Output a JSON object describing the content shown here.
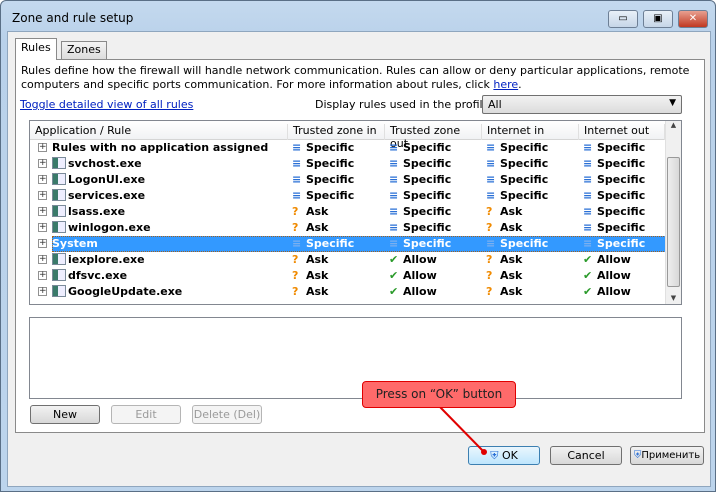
{
  "window": {
    "title": "Zone and rule setup",
    "minimize": "▭",
    "maximize": "▣",
    "close": "✕"
  },
  "tabs": [
    {
      "label": "Rules",
      "active": true
    },
    {
      "label": "Zones",
      "active": false
    }
  ],
  "description": "Rules define how the firewall will handle network communication. Rules can allow or deny particular applications, remote computers and specific ports communication. For more information about rules, click ",
  "here_link": "here",
  "toggle_link": "Toggle detailed view of all rules",
  "profile_label": "Display rules used in the profile:",
  "profile_value": "All",
  "columns": [
    "Application / Rule",
    "Trusted zone in",
    "Trusted zone out",
    "Internet in",
    "Internet out"
  ],
  "rows": [
    {
      "name": "Rules with no application assigned",
      "icon": "none",
      "vals": [
        "Specific",
        "Specific",
        "Specific",
        "Specific"
      ]
    },
    {
      "name": "svchost.exe",
      "icon": "app-window-icon",
      "vals": [
        "Specific",
        "Specific",
        "Specific",
        "Specific"
      ]
    },
    {
      "name": "LogonUI.exe",
      "icon": "app-window-icon",
      "vals": [
        "Specific",
        "Specific",
        "Specific",
        "Specific"
      ]
    },
    {
      "name": "services.exe",
      "icon": "app-window-icon",
      "vals": [
        "Specific",
        "Specific",
        "Specific",
        "Specific"
      ]
    },
    {
      "name": "lsass.exe",
      "icon": "app-window-icon",
      "vals": [
        "Ask",
        "Specific",
        "Ask",
        "Specific"
      ]
    },
    {
      "name": "winlogon.exe",
      "icon": "winlogon-icon",
      "vals": [
        "Ask",
        "Specific",
        "Ask",
        "Specific"
      ]
    },
    {
      "name": "System",
      "icon": "none",
      "selected": true,
      "vals": [
        "Specific",
        "Specific",
        "Specific",
        "Specific"
      ]
    },
    {
      "name": "iexplore.exe",
      "icon": "internet-explorer-icon",
      "vals": [
        "Ask",
        "Allow",
        "Ask",
        "Allow"
      ]
    },
    {
      "name": "dfsvc.exe",
      "icon": "app-window-icon",
      "vals": [
        "Ask",
        "Allow",
        "Ask",
        "Allow"
      ]
    },
    {
      "name": "GoogleUpdate.exe",
      "icon": "google-update-icon",
      "vals": [
        "Ask",
        "Allow",
        "Ask",
        "Allow"
      ]
    }
  ],
  "buttons": {
    "new": "New",
    "edit": "Edit",
    "delete": "Delete (Del)",
    "ok": "OK",
    "cancel": "Cancel",
    "apply": "Применить"
  },
  "callout": "Press on “OK” button",
  "colors": {
    "selection": "#3399ff",
    "callout": "#ff6a6a",
    "specific": "#2a6fd6",
    "ask": "#f08a00",
    "allow": "#2a9a2a"
  }
}
